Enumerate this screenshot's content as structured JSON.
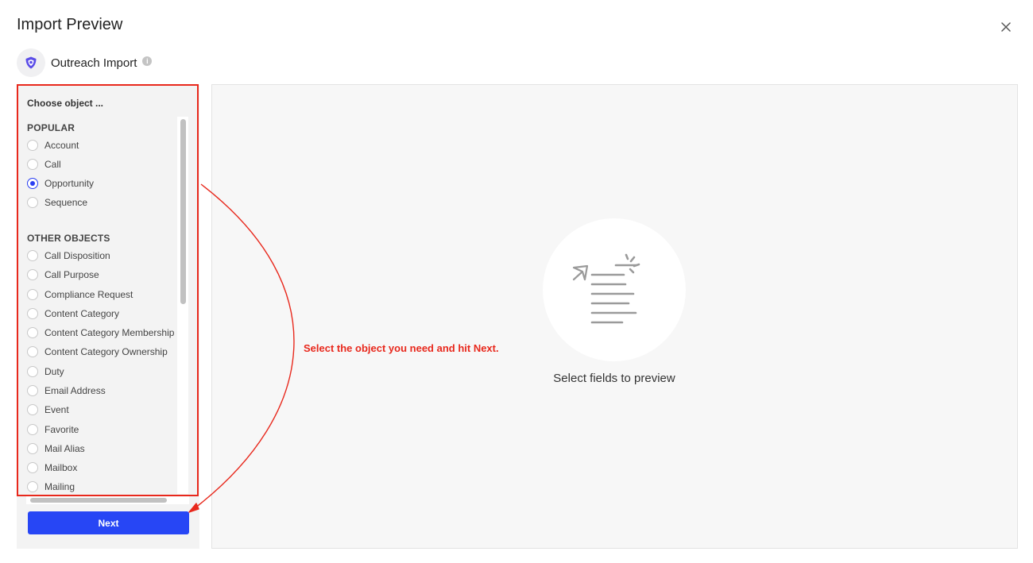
{
  "dialog": {
    "title": "Import Preview",
    "close_icon": "close-icon"
  },
  "source": {
    "name": "Outreach Import",
    "logo_icon": "outreach-shield-icon",
    "info_icon": "info-icon",
    "info_glyph": "i"
  },
  "object_picker": {
    "heading": "Choose object ...",
    "sections": [
      {
        "label": "POPULAR",
        "items": [
          "Account",
          "Call",
          "Opportunity",
          "Sequence"
        ]
      },
      {
        "label": "OTHER OBJECTS",
        "items": [
          "Call Disposition",
          "Call Purpose",
          "Compliance Request",
          "Content Category",
          "Content Category Membership",
          "Content Category Ownership",
          "Duty",
          "Email Address",
          "Event",
          "Favorite",
          "Mail Alias",
          "Mailbox",
          "Mailing"
        ]
      }
    ],
    "selected": "Opportunity"
  },
  "actions": {
    "next_label": "Next"
  },
  "preview": {
    "empty_message": "Select fields to preview",
    "illustration_icon": "document-send-icon"
  },
  "annotation": {
    "text": "Select the object you need and hit Next.",
    "color": "#e8281c"
  },
  "colors": {
    "accent": "#2746f5",
    "annotation": "#e8281c"
  }
}
